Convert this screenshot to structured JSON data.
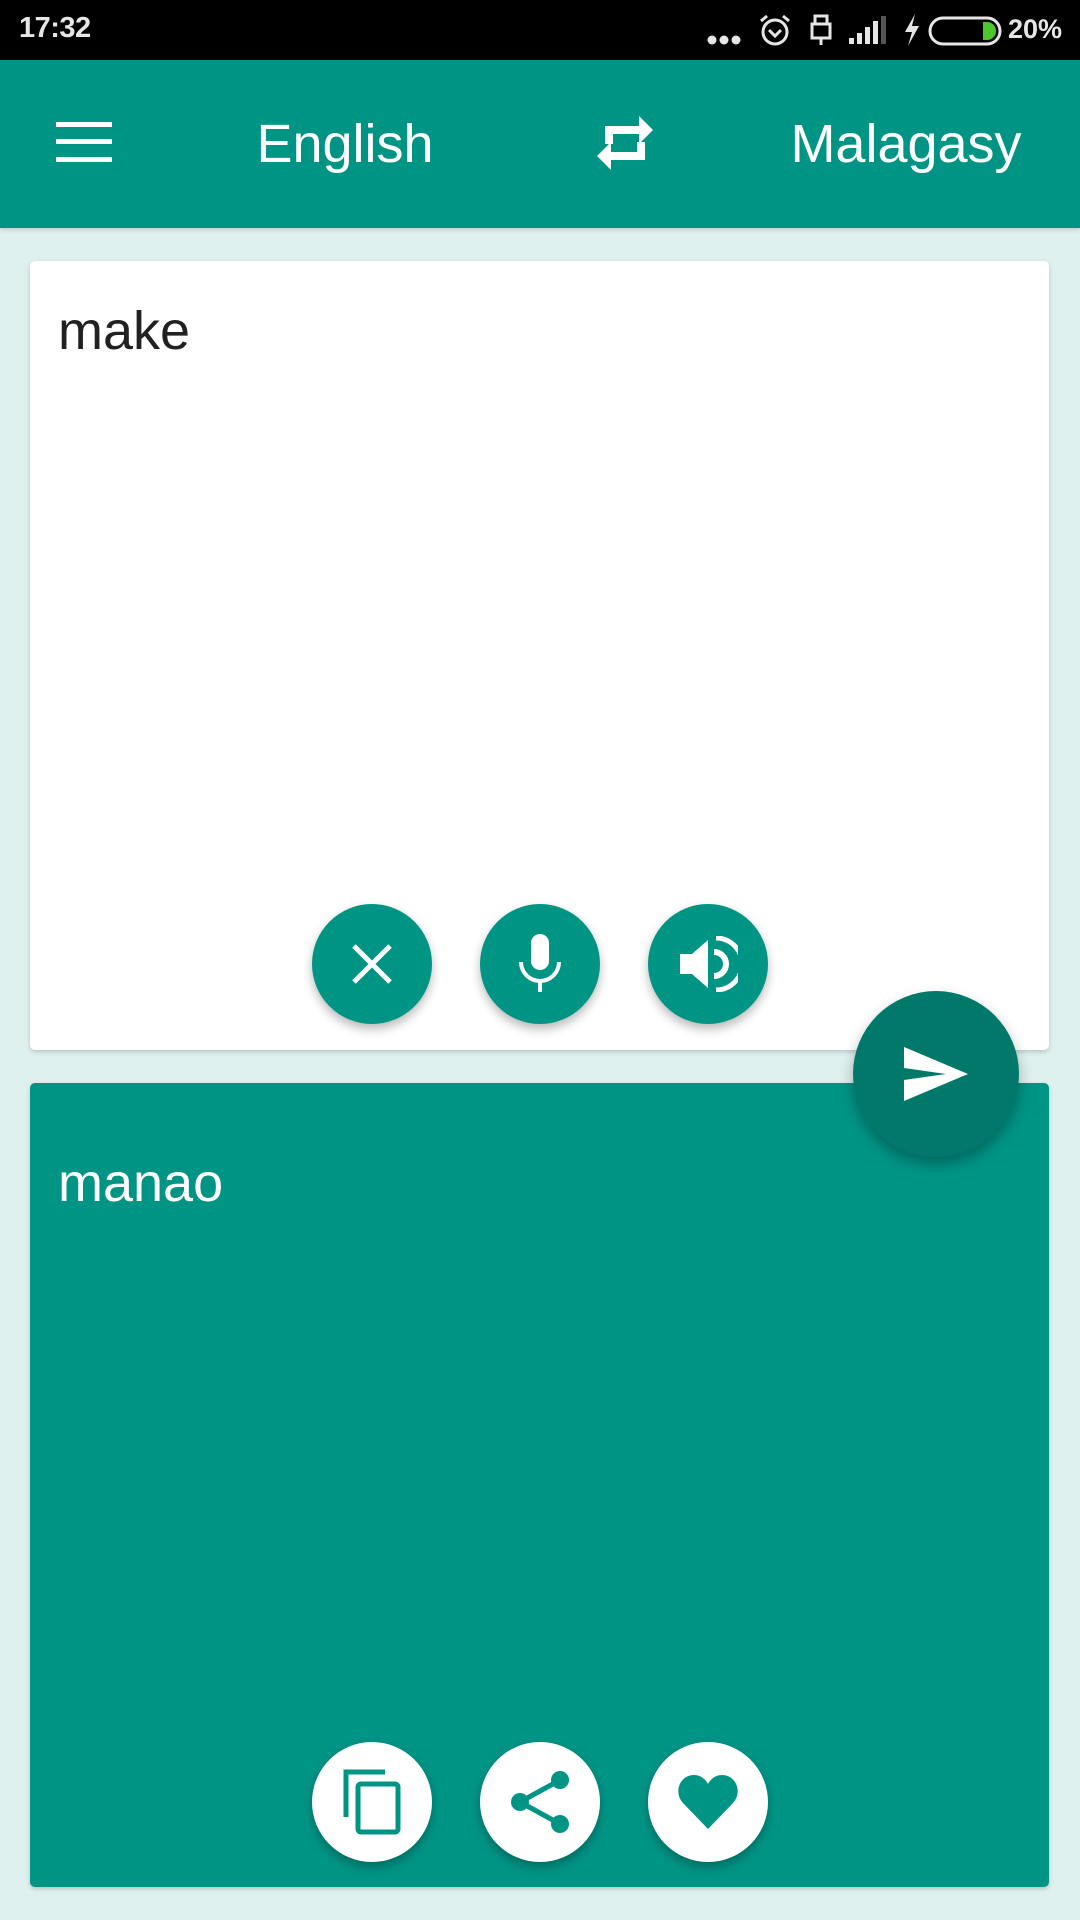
{
  "status_bar": {
    "time": "17:32",
    "battery_percent": "20%",
    "battery_level": 0.2,
    "icons": [
      "more-notifications-icon",
      "alarm-icon",
      "usb-icon",
      "signal-icon",
      "charging-icon",
      "battery-icon"
    ]
  },
  "app_bar": {
    "menu_icon": "hamburger-menu-icon",
    "source_language": "English",
    "swap_icon": "swap-languages-icon",
    "target_language": "Malagasy"
  },
  "input": {
    "text": "make",
    "actions": [
      {
        "name": "clear",
        "icon": "close-icon"
      },
      {
        "name": "voice-input",
        "icon": "microphone-icon"
      },
      {
        "name": "speak",
        "icon": "speaker-icon"
      }
    ]
  },
  "translate_button": {
    "icon": "send-icon"
  },
  "output": {
    "text": "manao",
    "actions": [
      {
        "name": "copy",
        "icon": "copy-icon"
      },
      {
        "name": "share",
        "icon": "share-icon"
      },
      {
        "name": "favorite",
        "icon": "heart-icon"
      }
    ]
  },
  "colors": {
    "primary": "#009485",
    "primary_dark": "#00796b",
    "background": "#dff1ee",
    "status_bar": "#000000",
    "battery_green": "#4cc92a"
  }
}
